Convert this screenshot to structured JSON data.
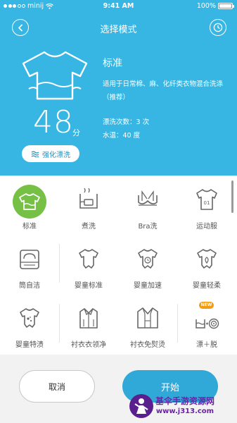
{
  "status_bar": {
    "carrier": "minij",
    "time": "9:41 AM",
    "battery": "100%"
  },
  "header": {
    "title": "选择模式"
  },
  "current_mode": {
    "name": "标准",
    "description": "适用于日常棉、麻、化纤类衣物混合洗涤（推荐）",
    "duration_value": "48",
    "duration_unit": "分",
    "boost_label": "强化漂洗",
    "rinse_text": "漂洗次数：3 次",
    "temp_text": "水温：40 度"
  },
  "modes": [
    {
      "id": "standard",
      "label": "标准",
      "icon": "t-shirt-icon",
      "selected": true
    },
    {
      "id": "boil",
      "label": "煮洗",
      "icon": "boil-pot-icon"
    },
    {
      "id": "bra",
      "label": "Bra洗",
      "icon": "bra-icon"
    },
    {
      "id": "sportswear",
      "label": "运动服",
      "icon": "jersey-icon"
    },
    {
      "id": "drum_clean",
      "label": "筒自洁",
      "icon": "drum-clean-icon"
    },
    {
      "id": "baby_standard",
      "label": "婴童标准",
      "icon": "baby-onesie-icon"
    },
    {
      "id": "baby_fast",
      "label": "婴童加速",
      "icon": "baby-onesie-fast-icon"
    },
    {
      "id": "baby_gentle",
      "label": "婴童轻柔",
      "icon": "baby-onesie-gentle-icon"
    },
    {
      "id": "baby_stain",
      "label": "婴童特渍",
      "icon": "baby-onesie-stain-icon"
    },
    {
      "id": "shirt_collar",
      "label": "衬衣衣领净",
      "icon": "dress-shirt-icon"
    },
    {
      "id": "shirt_noiron",
      "label": "衬衣免熨烫",
      "icon": "dress-shirt-jacket-icon"
    },
    {
      "id": "rinse_spin",
      "label": "漂＋脱",
      "icon": "rinse-spin-icon",
      "badge": "NEW"
    }
  ],
  "actions": {
    "cancel_label": "取消",
    "start_label": "开始"
  },
  "watermark": {
    "title": "基伞手游资源网",
    "url": "www.j313.com"
  },
  "colors": {
    "header_bg": "#38b6e3",
    "selected": "#75c045",
    "start_button": "#31a9d8"
  }
}
